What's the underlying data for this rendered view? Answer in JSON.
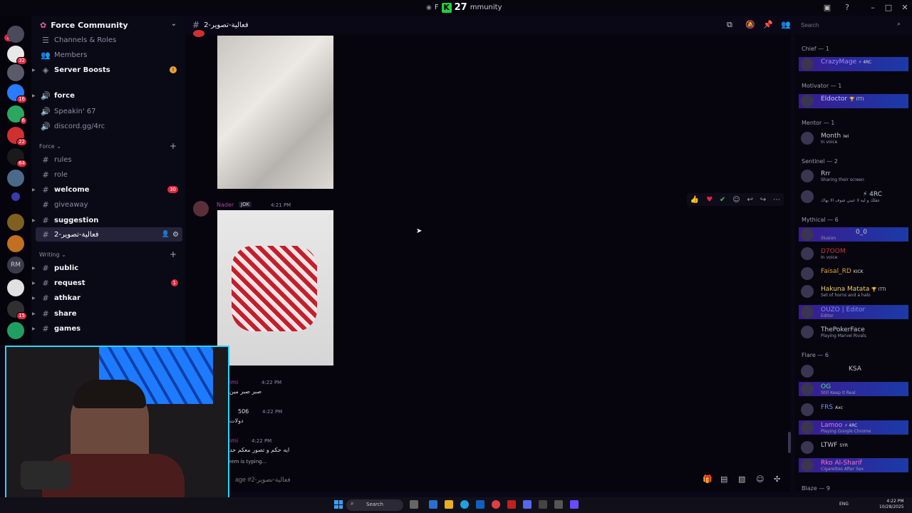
{
  "titlebar": {
    "left_text": "F",
    "right_text": "mmunity",
    "badge": "K",
    "number": "27"
  },
  "server_rail": {
    "new_badge": "NEW",
    "badges": [
      "32",
      "16",
      "6",
      "22",
      "64",
      "15",
      "RM"
    ]
  },
  "sidebar": {
    "server_name": "Force Community",
    "top_items": [
      {
        "label": "Channels & Roles",
        "icon": "channels-icon"
      },
      {
        "label": "Members",
        "icon": "members-icon"
      },
      {
        "label": "Server Boosts",
        "icon": "boost-icon",
        "badge": "!"
      }
    ],
    "voice_items": [
      {
        "label": "force"
      },
      {
        "label": "Speakin' 67"
      },
      {
        "label": "discord.gg/4rc"
      }
    ],
    "categories": [
      {
        "name": "Force ⌄",
        "channels": [
          {
            "label": "rules",
            "bold": false
          },
          {
            "label": "role",
            "bold": false
          },
          {
            "label": "welcome",
            "bold": true,
            "badge": "30"
          },
          {
            "label": "giveaway",
            "bold": false
          },
          {
            "label": "suggestion",
            "bold": true
          },
          {
            "label": "2-فعالية-تصوير",
            "bold": false,
            "active": true
          }
        ]
      },
      {
        "name": "Writing ⌄",
        "channels": [
          {
            "label": "public",
            "bold": true
          },
          {
            "label": "request",
            "bold": true,
            "badge": "1"
          },
          {
            "label": "athkar",
            "bold": true
          },
          {
            "label": "share",
            "bold": true
          },
          {
            "label": "games",
            "bold": true
          }
        ]
      }
    ]
  },
  "header": {
    "channel": "2-فعالية-تصوير",
    "search_placeholder": "Search"
  },
  "messages": {
    "nader": {
      "author": "Nader",
      "tag": "JOK",
      "time": "4:21 PM"
    },
    "m1": {
      "author": "imi",
      "time": "4:22 PM",
      "text": "صبر صبر مين"
    },
    "m2": {
      "author": "506",
      "time": "4:22 PM",
      "text": "دولات"
    },
    "m3": {
      "author": "imi",
      "time": "4:22 PM",
      "text": "ايه حكم و تصور معكم حد"
    },
    "typing": "eem is typing..."
  },
  "input": {
    "placeholder": "age #2-فعالية-تصوير"
  },
  "members": {
    "roles": [
      {
        "name": "Chief — 1",
        "members": [
          {
            "name": "CrazyMage",
            "tag": "⚡ 4RC",
            "color": "#7b5cff",
            "highlight": true
          }
        ]
      },
      {
        "name": "Motivator — 1",
        "members": [
          {
            "name": "Eldoctor",
            "tag": "🏆 ITTI",
            "color": "#cfc3ff",
            "highlight": true
          }
        ]
      },
      {
        "name": "Mentor — 1",
        "members": [
          {
            "name": "Month",
            "tag": "iwi",
            "status": "In voice",
            "color": "#c8c9d0"
          }
        ]
      },
      {
        "name": "Sentinel — 2",
        "members": [
          {
            "name": "Rrr",
            "status": "Sharing their screen",
            "color": "#c8c9d0"
          },
          {
            "name": "",
            "tag": "⚡ 4RC",
            "status": "عقلك و ليه لا عيني شوف الا بهاك",
            "color": "#c8c9d0"
          }
        ]
      },
      {
        "name": "Mythical — 6",
        "members": [
          {
            "name": "",
            "tag": "0_0",
            "status": "illusion",
            "color": "#c8c9d0",
            "highlight": true
          },
          {
            "name": "D7OOM",
            "status": "In voice",
            "color": "#c43a3a"
          },
          {
            "name": "Faisal_RD",
            "tag": "KICK",
            "color": "#e8a23a"
          },
          {
            "name": "Hakuna Matata",
            "tag": "🏆 ITTI",
            "status": "Set of horns and a halo",
            "color": "#f0d060"
          },
          {
            "name": "OUZO | Editor",
            "status": "Editor",
            "color": "#7a8cff",
            "highlight": true
          },
          {
            "name": "ThePokerFace",
            "status": "Playing Marvel Rivals",
            "color": "#c8c9d0"
          }
        ]
      },
      {
        "name": "Flare — 6",
        "members": [
          {
            "name": "",
            "tag": "KSA",
            "color": "#c8c9d0"
          },
          {
            "name": "OG",
            "status": "Still Keep it Real",
            "color": "#50e070",
            "highlight": true
          },
          {
            "name": "FRS",
            "tag": "Axc",
            "color": "#7a8cff"
          },
          {
            "name": "Lamoo",
            "tag": "⚡ 4RC",
            "status": "Playing Google Chrome",
            "color": "#e070ff",
            "highlight": true
          },
          {
            "name": "LTWF",
            "tag": "SYR",
            "color": "#c8c9d0"
          },
          {
            "name": "Rko Al-Sharif",
            "status": "Cigarettes After Sex",
            "color": "#ff70c0",
            "highlight": true
          }
        ]
      },
      {
        "name": "Blaze — 9",
        "members": []
      }
    ]
  },
  "taskbar": {
    "search": "Search",
    "lang": "ENG",
    "time": "4:22 PM",
    "date": "10/28/2025"
  }
}
